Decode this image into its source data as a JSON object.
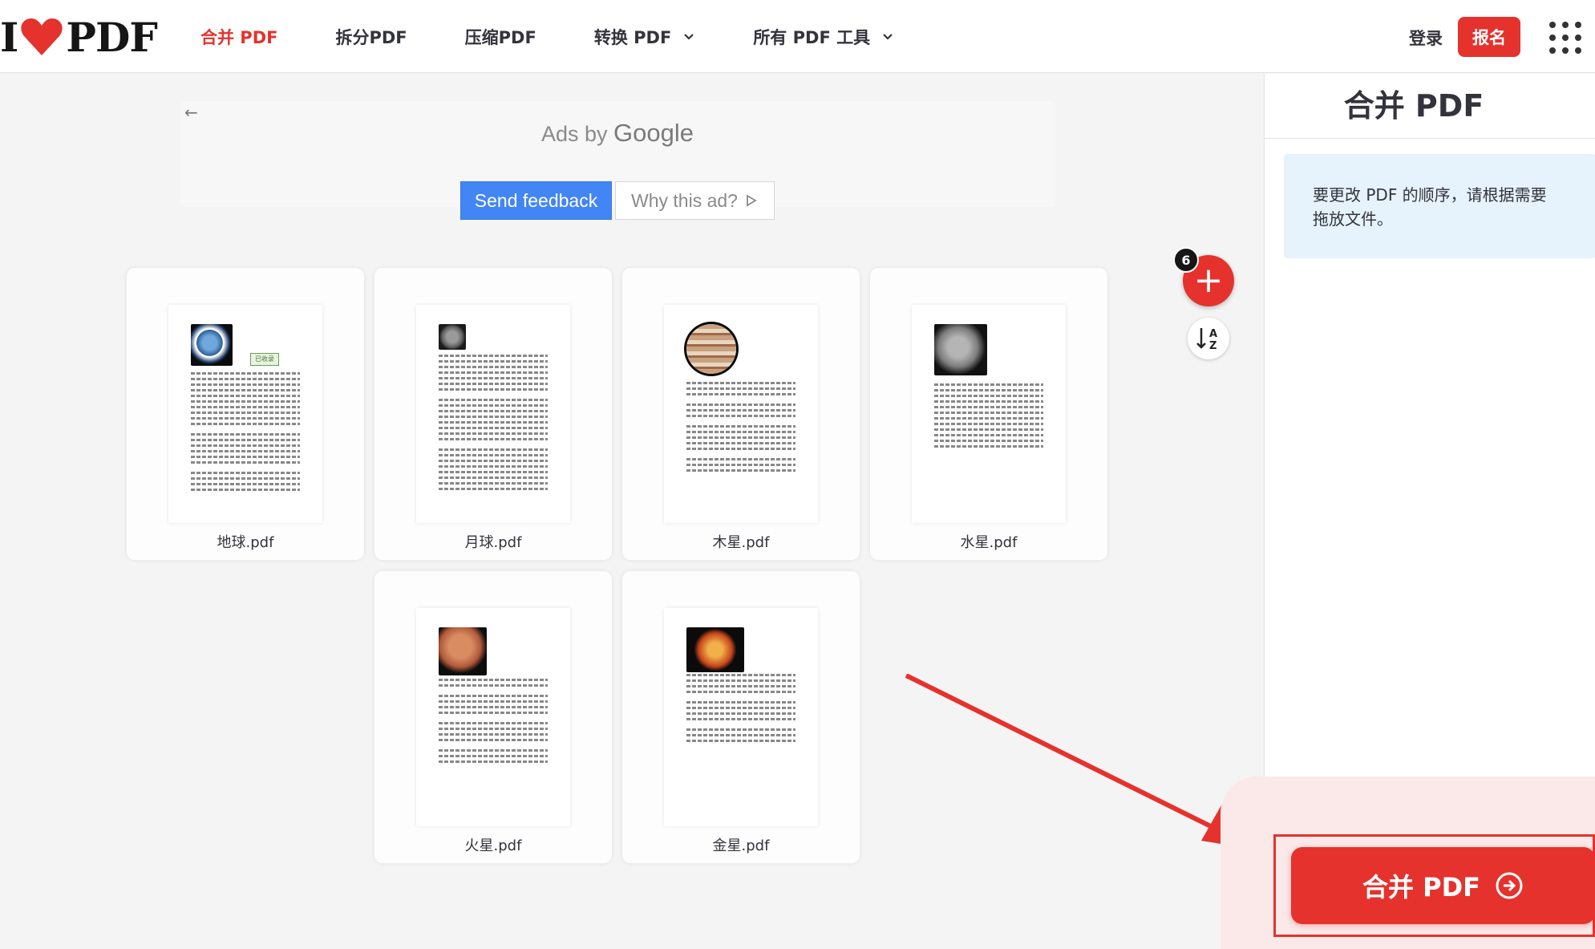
{
  "brand": {
    "logo_left": "I",
    "logo_right": "PDF",
    "accent": "#e5322d"
  },
  "nav": {
    "items": [
      {
        "label": "合并 PDF",
        "active": true,
        "dropdown": false
      },
      {
        "label": "拆分PDF",
        "active": false,
        "dropdown": false
      },
      {
        "label": "压缩PDF",
        "active": false,
        "dropdown": false
      },
      {
        "label": "转换 PDF",
        "active": false,
        "dropdown": true
      },
      {
        "label": "所有 PDF 工具",
        "active": false,
        "dropdown": true
      }
    ],
    "login": "登录",
    "signup": "报名"
  },
  "ad": {
    "ads_by": "Ads by",
    "google": "Google",
    "send_feedback": "Send feedback",
    "why_this_ad": "Why this ad?"
  },
  "files": {
    "count": "6",
    "items": [
      {
        "name": "地球.pdf",
        "image": "earth"
      },
      {
        "name": "月球.pdf",
        "image": "moon"
      },
      {
        "name": "木星.pdf",
        "image": "jupiter"
      },
      {
        "name": "水星.pdf",
        "image": "mercury"
      },
      {
        "name": "火星.pdf",
        "image": "mars"
      },
      {
        "name": "金星.pdf",
        "image": "venus"
      }
    ],
    "badge_text": "已收录"
  },
  "sidebar": {
    "title": "合并 PDF",
    "info_line1": "要更改 PDF 的顺序，请根据需要",
    "info_line2": "拖放文件。",
    "merge_button": "合并 PDF"
  },
  "icons": {
    "add": "plus-icon",
    "sort": "sort-az-icon",
    "apps": "grid-menu-icon",
    "merge": "arrow-right-circle-icon",
    "chevron": "chevron-down-icon",
    "back": "arrow-left-icon"
  }
}
